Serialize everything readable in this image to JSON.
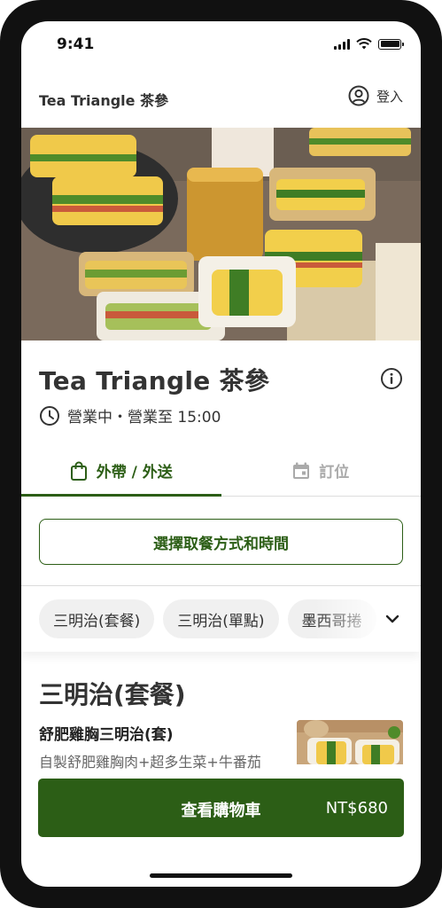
{
  "status_bar": {
    "time": "9:41"
  },
  "header": {
    "title": "Tea Triangle 茶參",
    "login_label": "登入"
  },
  "store": {
    "name": "Tea Triangle 茶參",
    "hours": "營業中・營業至 15:00"
  },
  "tabs": [
    {
      "label": "外帶 / 外送",
      "icon": "shopping-bag-icon",
      "active": true
    },
    {
      "label": "訂位",
      "icon": "calendar-icon",
      "active": false
    }
  ],
  "pickup": {
    "label": "選擇取餐方式和時間"
  },
  "categories": [
    "三明治(套餐)",
    "三明治(單點)",
    "墨西哥捲"
  ],
  "menu": {
    "section_title": "三明治(套餐)",
    "item": {
      "name": "舒肥雞胸三明治(套)",
      "description": "自製舒肥雞胸肉+超多生菜+牛番茄"
    }
  },
  "cart": {
    "label": "查看購物車",
    "total": "NT$680"
  },
  "colors": {
    "accent": "#2c5e16",
    "chip_bg": "#f0f0f0",
    "divider": "#dddddd"
  }
}
